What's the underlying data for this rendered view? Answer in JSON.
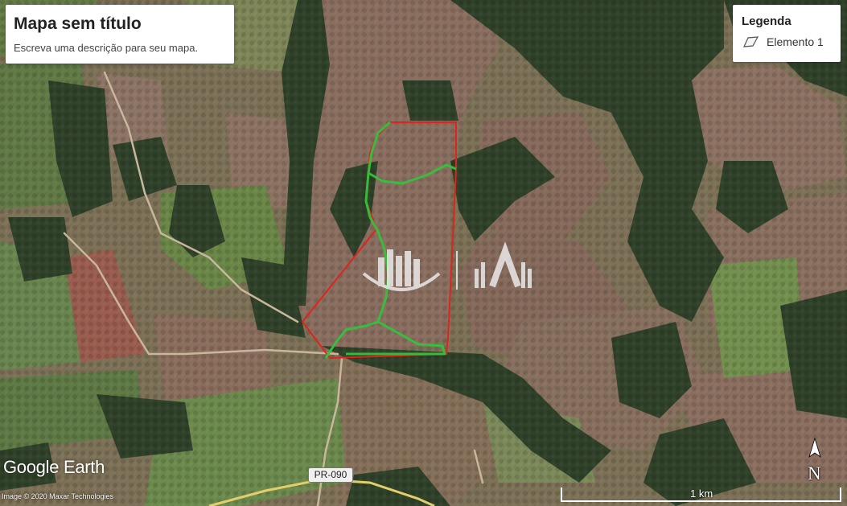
{
  "map": {
    "title": "Mapa sem título",
    "description": "Escreva uma descrição para seu mapa."
  },
  "legend": {
    "title": "Legenda",
    "items": [
      {
        "label": "Elemento 1",
        "icon": "polygon-icon"
      }
    ]
  },
  "branding": {
    "logo_text": "Google Earth",
    "attribution": "Image © 2020 Maxar Technologies"
  },
  "road_label": "PR-090",
  "north_label": "N",
  "scale_label": "1 km",
  "colors": {
    "boundary_red": "#e0231c",
    "path_green": "#2fc43a",
    "forest": "#2f3f26",
    "pasture": "#7f6e5d",
    "field_green": "#6f8a4c"
  }
}
